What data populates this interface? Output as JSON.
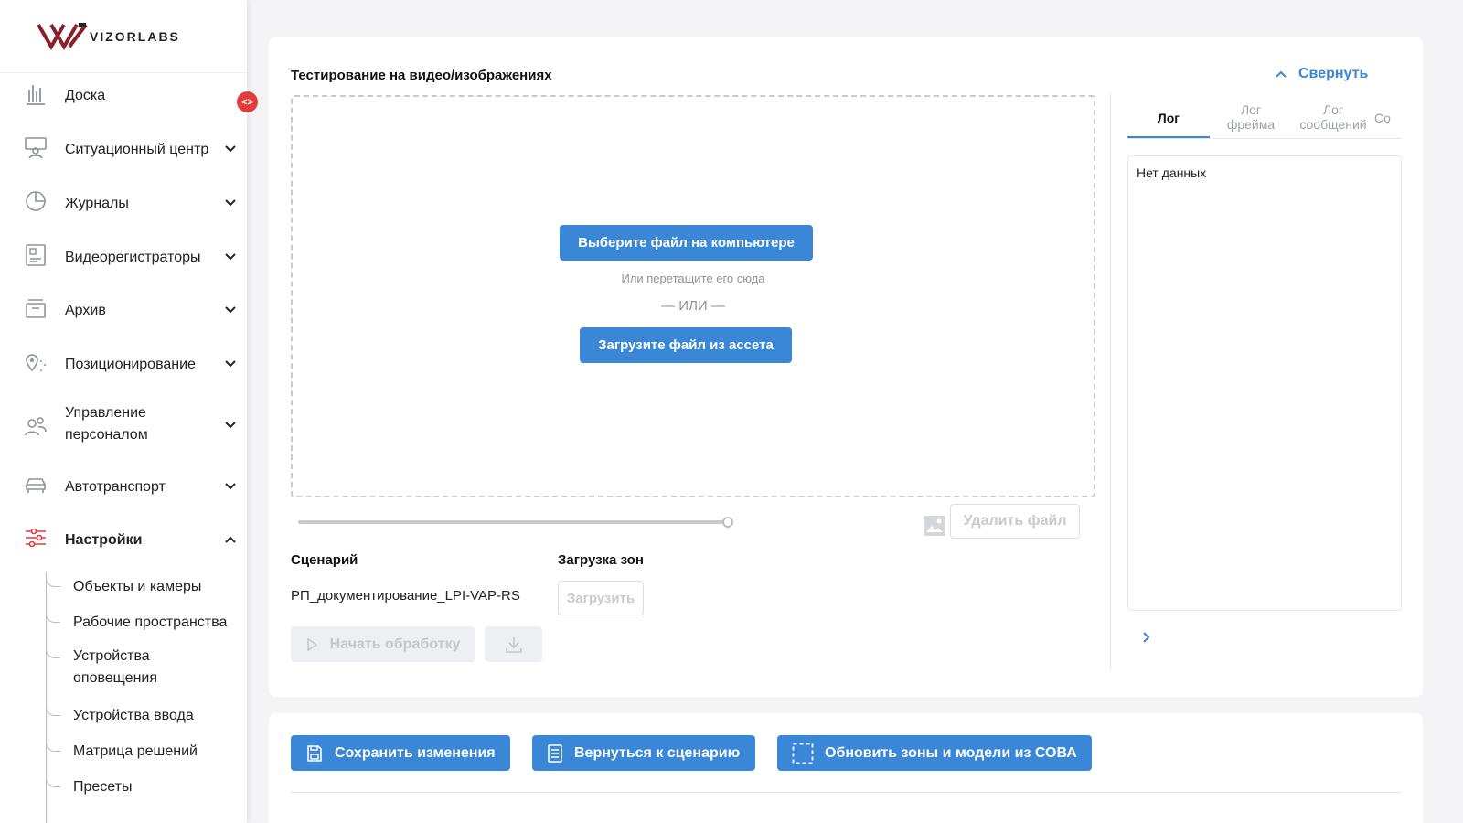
{
  "brand": {
    "name": "VIZORLABS",
    "accent": "#3a87d8",
    "logo_color": "#8b1f2a"
  },
  "sidebar": {
    "collapse_toggle": "<>",
    "items": [
      {
        "label": "Доска",
        "icon": "chart-bars-icon"
      },
      {
        "label": "Ситуационный центр",
        "icon": "situation-center-icon"
      },
      {
        "label": "Журналы",
        "icon": "pie-chart-icon"
      },
      {
        "label": "Видеорегистраторы",
        "icon": "recorder-icon"
      },
      {
        "label": "Архив",
        "icon": "archive-box-icon"
      },
      {
        "label": "Позиционирование",
        "icon": "map-pin-icon"
      },
      {
        "label": "Управление\nперсоналом",
        "icon": "people-icon"
      },
      {
        "label": "Автотранспорт",
        "icon": "car-icon"
      },
      {
        "label": "Настройки",
        "icon": "sliders-icon"
      }
    ],
    "settings_sub": [
      {
        "label": "Объекты и камеры"
      },
      {
        "label": "Рабочие пространства"
      },
      {
        "label": "Устройства\nоповещения"
      },
      {
        "label": "Устройства ввода"
      },
      {
        "label": "Матрица решений"
      },
      {
        "label": "Пресеты"
      }
    ]
  },
  "testing": {
    "title": "Тестирование на видео/изображениях",
    "collapse_label": "Свернуть",
    "choose_file": "Выберите файл на компьютере",
    "drag_hint": "Или перетащите его сюда",
    "or": "— ИЛИ —",
    "load_asset": "Загрузите файл из ассета",
    "delete_file": "Удалить файл",
    "progress": 0.0,
    "scenario_label": "Сценарий",
    "scenario_value": "РП_документирование_LPI-VAP-RS",
    "zones_label": "Загрузка зон",
    "zones_button": "Загрузить",
    "start_processing": "Начать обработку"
  },
  "log_panel": {
    "tabs": [
      "Лог",
      "Лог\nфрейма",
      "Лог\nсообщений",
      "Со"
    ],
    "active_tab": 0,
    "empty": "Нет данных"
  },
  "actions": {
    "save": "Сохранить изменения",
    "back": "Вернуться к сценарию",
    "update": "Обновить зоны и модели из СОВА"
  }
}
